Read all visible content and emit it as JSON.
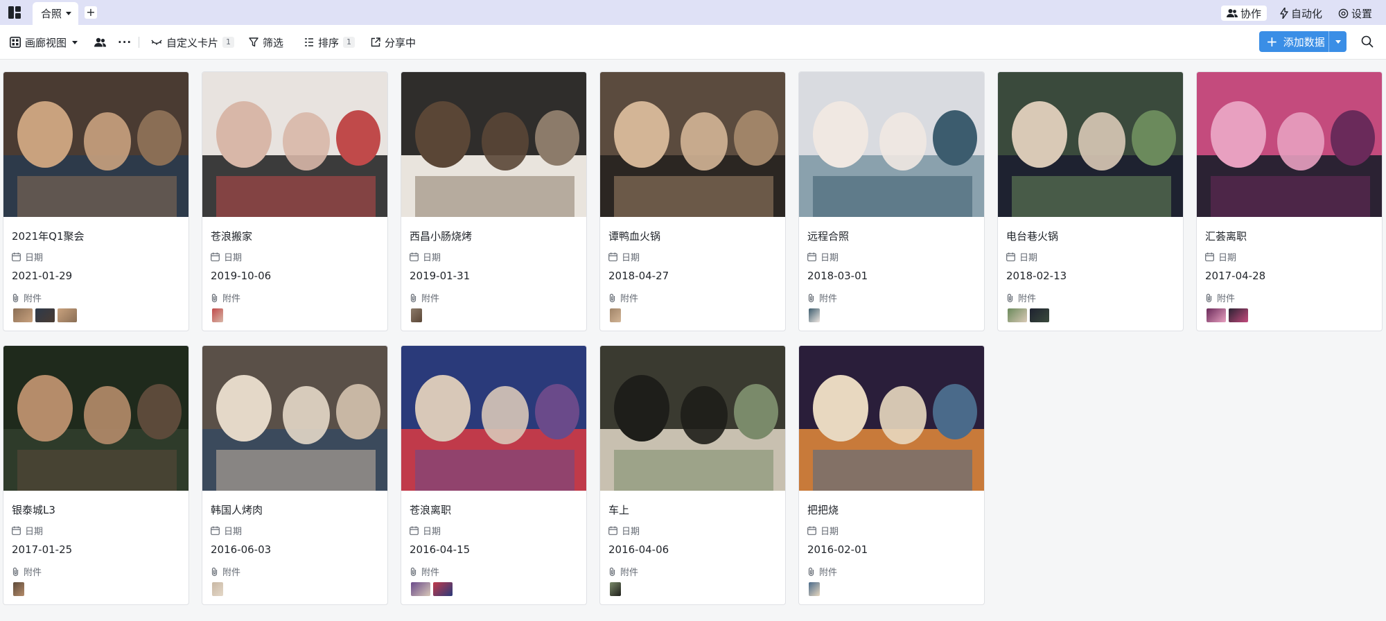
{
  "tabbar": {
    "tab_label": "合照",
    "add_label": "+",
    "collab_label": "协作",
    "automation_label": "自动化",
    "settings_label": "设置"
  },
  "toolbar": {
    "view_label": "画廊视图",
    "more_label": "···",
    "custom_card_label": "自定义卡片",
    "custom_card_count": "1",
    "filter_label": "筛选",
    "sort_label": "排序",
    "sort_count": "1",
    "share_label": "分享中",
    "add_data_label": "添加数据"
  },
  "fields": {
    "date_label": "日期",
    "attachment_label": "附件"
  },
  "cards": [
    {
      "title": "2021年Q1聚会",
      "date": "2021-01-29",
      "attachments": 3
    },
    {
      "title": "苍浪搬家",
      "date": "2019-10-06",
      "attachments": 1
    },
    {
      "title": "西昌小肠烧烤",
      "date": "2019-01-31",
      "attachments": 1
    },
    {
      "title": "谭鸭血火锅",
      "date": "2018-04-27",
      "attachments": 1
    },
    {
      "title": "远程合照",
      "date": "2018-03-01",
      "attachments": 1
    },
    {
      "title": "电台巷火锅",
      "date": "2018-02-13",
      "attachments": 2
    },
    {
      "title": "汇荟离职",
      "date": "2017-04-28",
      "attachments": 2
    },
    {
      "title": "银泰城L3",
      "date": "2017-01-25",
      "attachments": 1
    },
    {
      "title": "韩国人烤肉",
      "date": "2016-06-03",
      "attachments": 1
    },
    {
      "title": "苍浪离职",
      "date": "2016-04-15",
      "attachments": 2
    },
    {
      "title": "车上",
      "date": "2016-04-06",
      "attachments": 1
    },
    {
      "title": "把把烧",
      "date": "2016-02-01",
      "attachments": 1
    }
  ],
  "colors": {
    "tabbar_bg": "#dfe1f6",
    "accent": "#3a8ee6"
  }
}
